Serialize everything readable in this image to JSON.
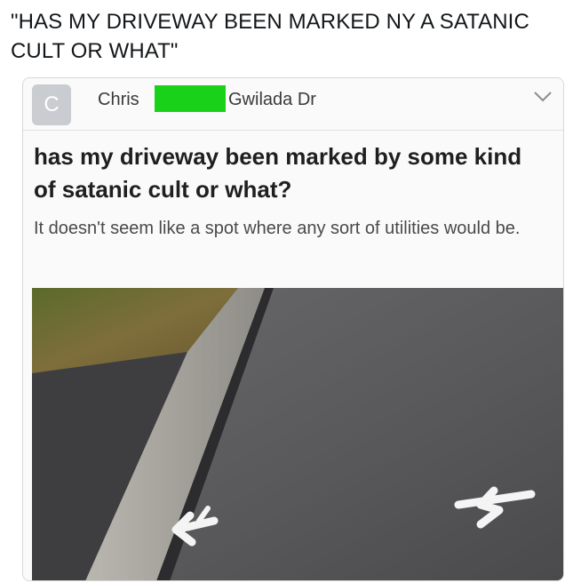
{
  "caption": "\"HAS MY DRIVEWAY BEEN MARKED NY A SATANIC CULT OR WHAT\"",
  "post": {
    "avatar_letter": "C",
    "author_first": "Chris",
    "author_street": "Gwilada Dr",
    "title": "has my driveway been marked by some kind of satanic cult or what?",
    "body": "It doesn't seem like a spot where any sort of utilities would be."
  },
  "colors": {
    "redaction": "#19d119",
    "avatar": "#c9ccd0",
    "asphalt": "#5a5a5c",
    "grass": "#6f6b30"
  },
  "icons": {
    "menu": "chevron-down-icon"
  }
}
